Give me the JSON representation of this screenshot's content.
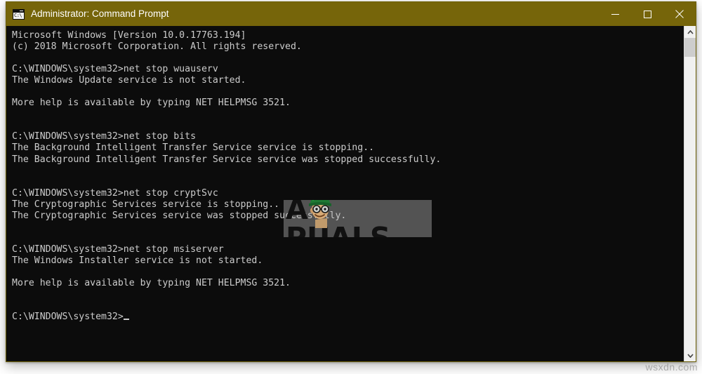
{
  "window": {
    "title": "Administrator: Command Prompt",
    "icon": "cmd-console-icon",
    "icon_prompt_text": "C:\\",
    "titlebar_color": "#76650a",
    "console_bg_color": "#0c0c0c",
    "console_fg_color": "#cccccc",
    "controls": {
      "minimize_label": "Minimize",
      "maximize_label": "Maximize",
      "close_label": "Close"
    }
  },
  "console": {
    "lines": [
      "Microsoft Windows [Version 10.0.17763.194]",
      "(c) 2018 Microsoft Corporation. All rights reserved.",
      "",
      "C:\\WINDOWS\\system32>net stop wuauserv",
      "The Windows Update service is not started.",
      "",
      "More help is available by typing NET HELPMSG 3521.",
      "",
      "",
      "C:\\WINDOWS\\system32>net stop bits",
      "The Background Intelligent Transfer Service service is stopping..",
      "The Background Intelligent Transfer Service service was stopped successfully.",
      "",
      "",
      "C:\\WINDOWS\\system32>net stop cryptSvc",
      "The Cryptographic Services service is stopping..",
      "The Cryptographic Services service was stopped successfully.",
      "",
      "",
      "C:\\WINDOWS\\system32>net stop msiserver",
      "The Windows Installer service is not started.",
      "",
      "More help is available by typing NET HELPMSG 3521.",
      "",
      "",
      "C:\\WINDOWS\\system32>"
    ],
    "prompt_line_index": 25,
    "cursor": "block-caret"
  },
  "scrollbar": {
    "up_arrow": "chevron-up-icon",
    "down_arrow": "chevron-down-icon",
    "thumb_position_percent": 0,
    "thumb_size_percent": 6
  },
  "watermarks": {
    "appuals": {
      "text_before": "A",
      "mascot": "appuals-mascot-icon",
      "text_after": "PUALS",
      "full_text": "APPUALS"
    },
    "site": "wsxdn.com"
  }
}
